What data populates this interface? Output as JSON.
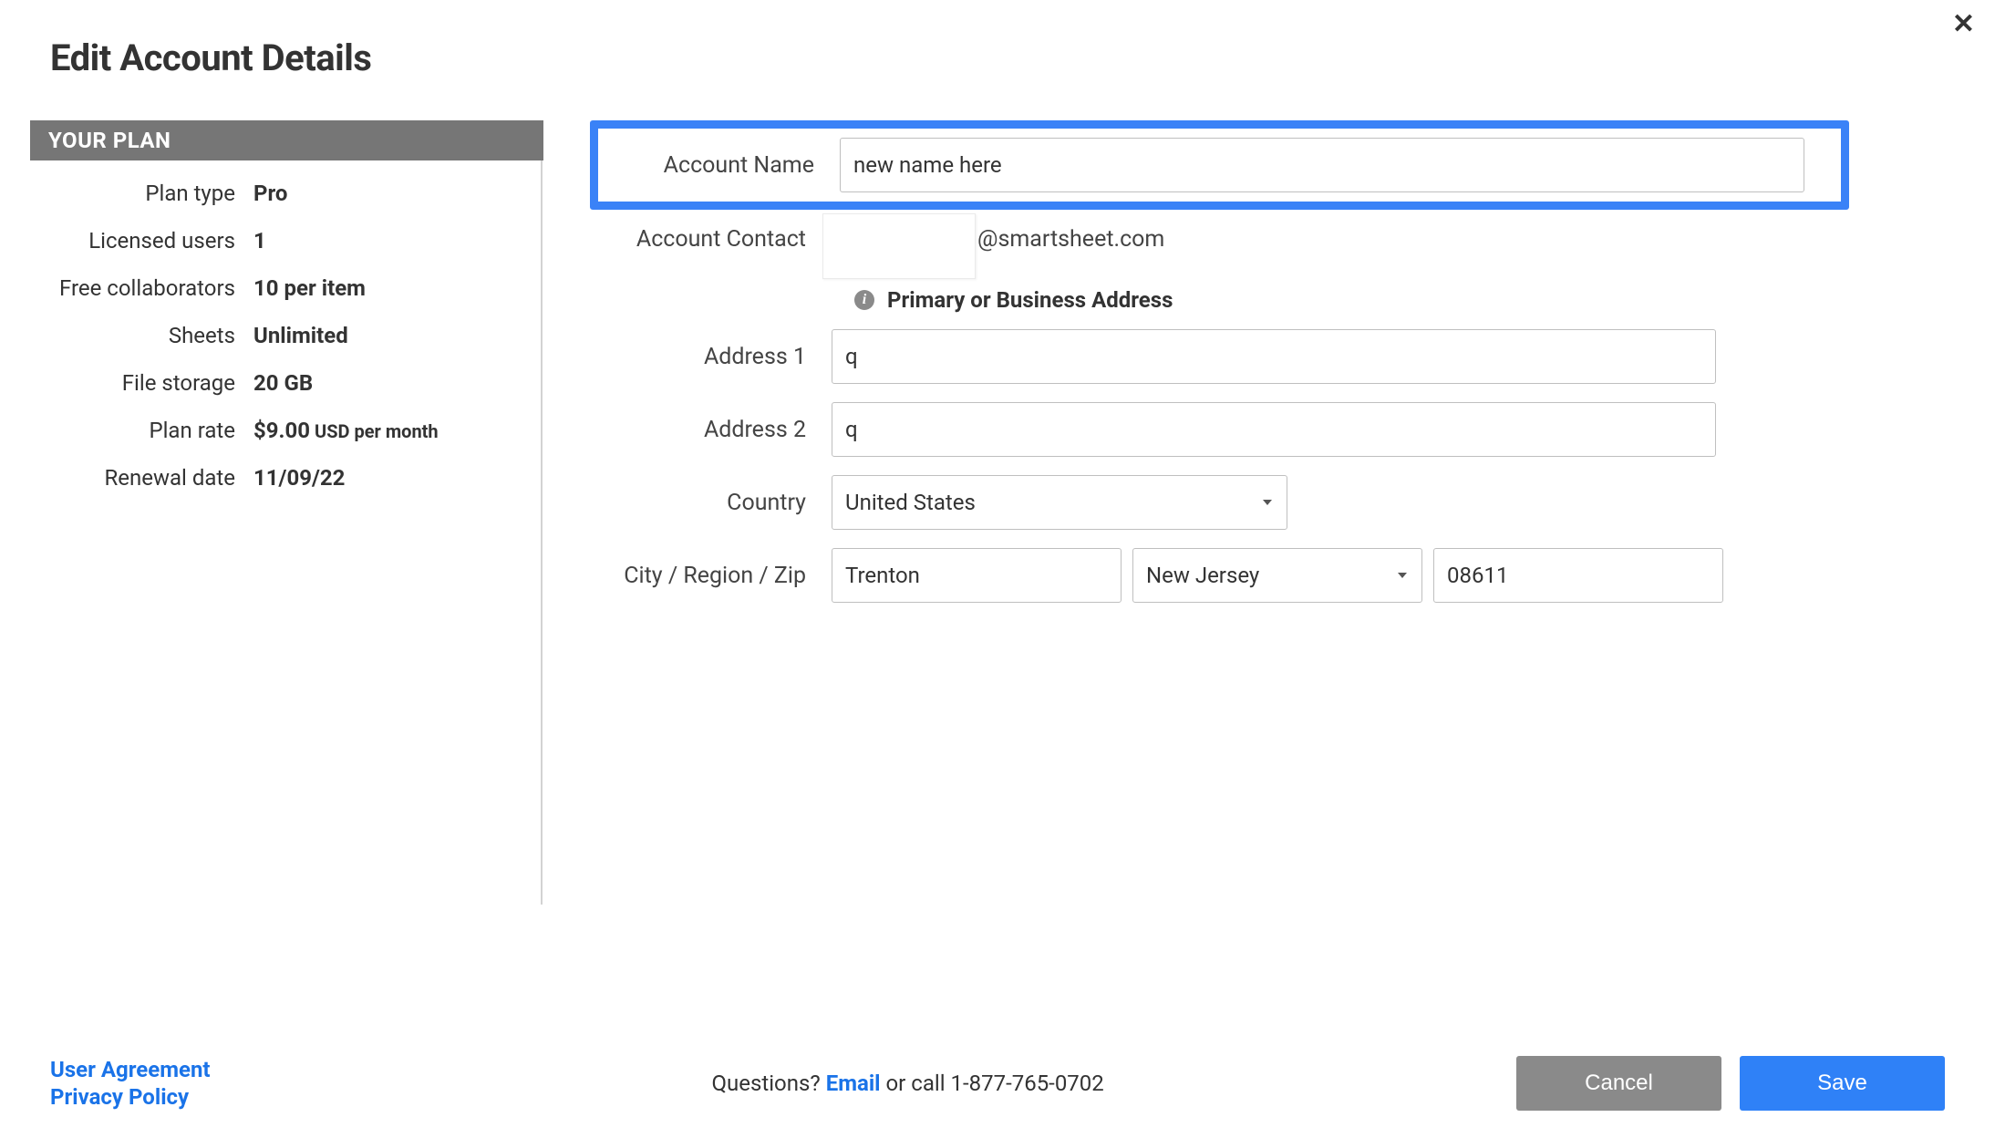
{
  "page_title": "Edit Account Details",
  "close_icon_glyph": "✕",
  "sidebar": {
    "plan_header": "YOUR PLAN",
    "rows": {
      "plan_type": {
        "label": "Plan type",
        "value": "Pro"
      },
      "licensed_users": {
        "label": "Licensed users",
        "value": "1"
      },
      "free_collaborators": {
        "label": "Free collaborators",
        "value": "10 per item"
      },
      "sheets": {
        "label": "Sheets",
        "value": "Unlimited"
      },
      "file_storage": {
        "label": "File storage",
        "value": "20 GB"
      },
      "plan_rate": {
        "label": "Plan rate",
        "price": "$9.00",
        "suffix": " USD per month"
      },
      "renewal_date": {
        "label": "Renewal date",
        "value": "11/09/22"
      }
    }
  },
  "form": {
    "account_name": {
      "label": "Account Name",
      "value": "new name here"
    },
    "account_contact": {
      "label": "Account Contact",
      "value_suffix": "@smartsheet.com"
    },
    "address_heading": "Primary or Business Address",
    "address1": {
      "label": "Address 1",
      "value": "q"
    },
    "address2": {
      "label": "Address 2",
      "value": "q"
    },
    "country": {
      "label": "Country",
      "value": "United States"
    },
    "city_region_zip_label": "City / Region / Zip",
    "city": "Trenton",
    "region": "New Jersey",
    "zip": "08611"
  },
  "footer": {
    "links": {
      "agreement": "User Agreement",
      "privacy": "Privacy Policy"
    },
    "questions_prefix": "Questions? ",
    "email_link": "Email",
    "questions_suffix": " or call 1-877-765-0702",
    "buttons": {
      "cancel": "Cancel",
      "save": "Save"
    }
  }
}
